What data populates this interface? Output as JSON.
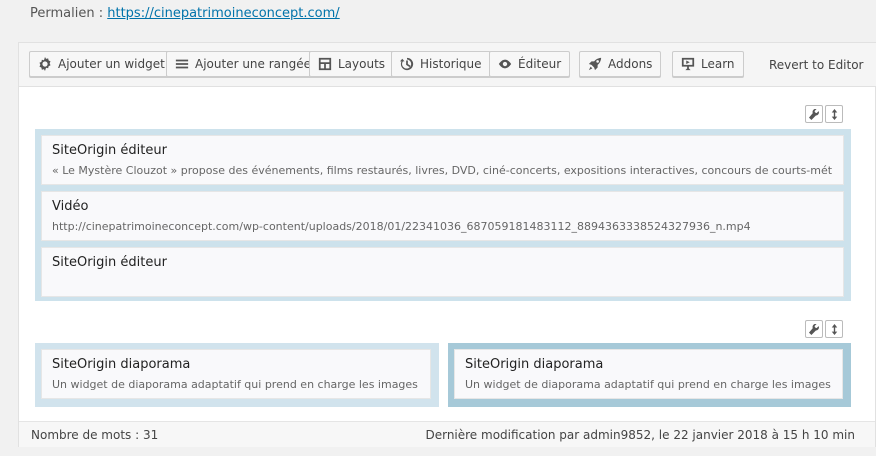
{
  "permalink": {
    "label": "Permalien :",
    "url": "https://cinepatrimoineconcept.com/"
  },
  "toolbar": {
    "buttons": [
      {
        "label": "Ajouter un widget",
        "icon": "gear-icon"
      },
      {
        "label": "Ajouter une rangée",
        "icon": "menu-lines-icon"
      },
      {
        "label": "Layouts",
        "icon": "layout-icon"
      },
      {
        "label": "Historique",
        "icon": "history-icon"
      },
      {
        "label": "Éditeur",
        "icon": "eye-icon"
      },
      {
        "label": "Addons",
        "icon": "rocket-icon"
      },
      {
        "label": "Learn",
        "icon": "presentation-icon"
      }
    ],
    "revert_label": "Revert to Editor"
  },
  "rows": [
    {
      "widgets": [
        {
          "title": "SiteOrigin éditeur",
          "description": "« Le Mystère Clouzot » propose des événements, films restaurés, livres, DVD, ciné-concerts, expositions interactives, concours de courts-métrages,"
        },
        {
          "title": "Vidéo",
          "description": "http://cinepatrimoineconcept.com/wp-content/uploads/2018/01/22341036_687059181483112_8894363338524327936_n.mp4"
        },
        {
          "title": "SiteOrigin éditeur",
          "description": ""
        }
      ]
    },
    {
      "cells": [
        {
          "title": "SiteOrigin diaporama",
          "description": "Un widget de diaporama adaptatif qui prend en charge les images et la"
        },
        {
          "title": "SiteOrigin diaporama",
          "description": "Un widget de diaporama adaptatif qui prend en charge les images et la"
        }
      ]
    }
  ],
  "footer": {
    "word_count": "Nombre de mots : 31",
    "last_modified": "Dernière modification par admin9852, le 22 janvier 2018 à 15 h 10 min"
  },
  "colors": {
    "link": "#0073aa",
    "row_bg": "#cde2ec",
    "active_cell": "#a6c9d8"
  }
}
